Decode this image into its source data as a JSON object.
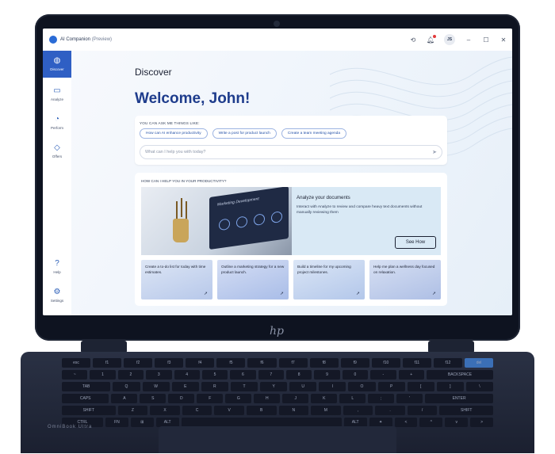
{
  "app": {
    "title": "AI Companion",
    "title_suffix": "(Preview)",
    "avatar_initials": "JS"
  },
  "titlebar_icons": [
    "history-icon",
    "notification-icon",
    "minimize-icon",
    "maximize-icon",
    "close-icon"
  ],
  "sidebar": {
    "items": [
      {
        "label": "Discover",
        "icon": "globe-icon",
        "active": true
      },
      {
        "label": "Analyze",
        "icon": "document-icon"
      },
      {
        "label": "Perform",
        "icon": "gauge-icon"
      },
      {
        "label": "Offers",
        "icon": "tag-icon"
      },
      {
        "label": "Help",
        "icon": "question-icon"
      },
      {
        "label": "Settings",
        "icon": "gear-icon"
      }
    ]
  },
  "main": {
    "heading": "Discover",
    "welcome": "Welcome, John!",
    "ask": {
      "label": "YOU CAN ASK ME THINGS LIKE:",
      "chips": [
        "How can AI enhance productivity",
        "Write a post for product launch",
        "Create a team meeting agenda"
      ],
      "placeholder": "What can I help you with today?"
    },
    "help": {
      "label": "HOW CAN I HELP YOU IN YOUR PRODUCTIVITY?",
      "image_caption": "Marketing Development",
      "hero_title": "Analyze your documents",
      "hero_desc": "Interact with Analyze to review and compare heavy text documents without manually reviewing them",
      "hero_button": "See How",
      "tiles": [
        "Create a to-do list for today with time estimates.",
        "Outline a marketing strategy for a new product launch.",
        "Build a timeline for my upcoming project milestones.",
        "Help me plan a wellness day focused on relaxation."
      ]
    }
  },
  "device": {
    "brand_mark": "hp",
    "model": "OmniBook Ultra",
    "keys_row1": [
      "esc",
      "f1",
      "f2",
      "f3",
      "f4",
      "f5",
      "f6",
      "f7",
      "f8",
      "f9",
      "f10",
      "f11",
      "f12",
      "del"
    ],
    "keys_row2": [
      "~",
      "1",
      "2",
      "3",
      "4",
      "5",
      "6",
      "7",
      "8",
      "9",
      "0",
      "-",
      "+",
      "BACKSPACE"
    ],
    "keys_row3": [
      "TAB",
      "Q",
      "W",
      "E",
      "R",
      "T",
      "Y",
      "U",
      "I",
      "O",
      "P",
      "[",
      "]",
      "\\"
    ],
    "keys_row4": [
      "CAPS",
      "A",
      "S",
      "D",
      "F",
      "G",
      "H",
      "J",
      "K",
      "L",
      ";",
      "'",
      "ENTER"
    ],
    "keys_row5": [
      "SHIFT",
      "Z",
      "X",
      "C",
      "V",
      "B",
      "N",
      "M",
      ",",
      ".",
      "/",
      "SHIFT"
    ],
    "keys_row6": [
      "CTRL",
      "FN",
      "⊞",
      "ALT",
      "",
      "ALT",
      "✦",
      "<",
      "^",
      "v",
      ">"
    ]
  }
}
